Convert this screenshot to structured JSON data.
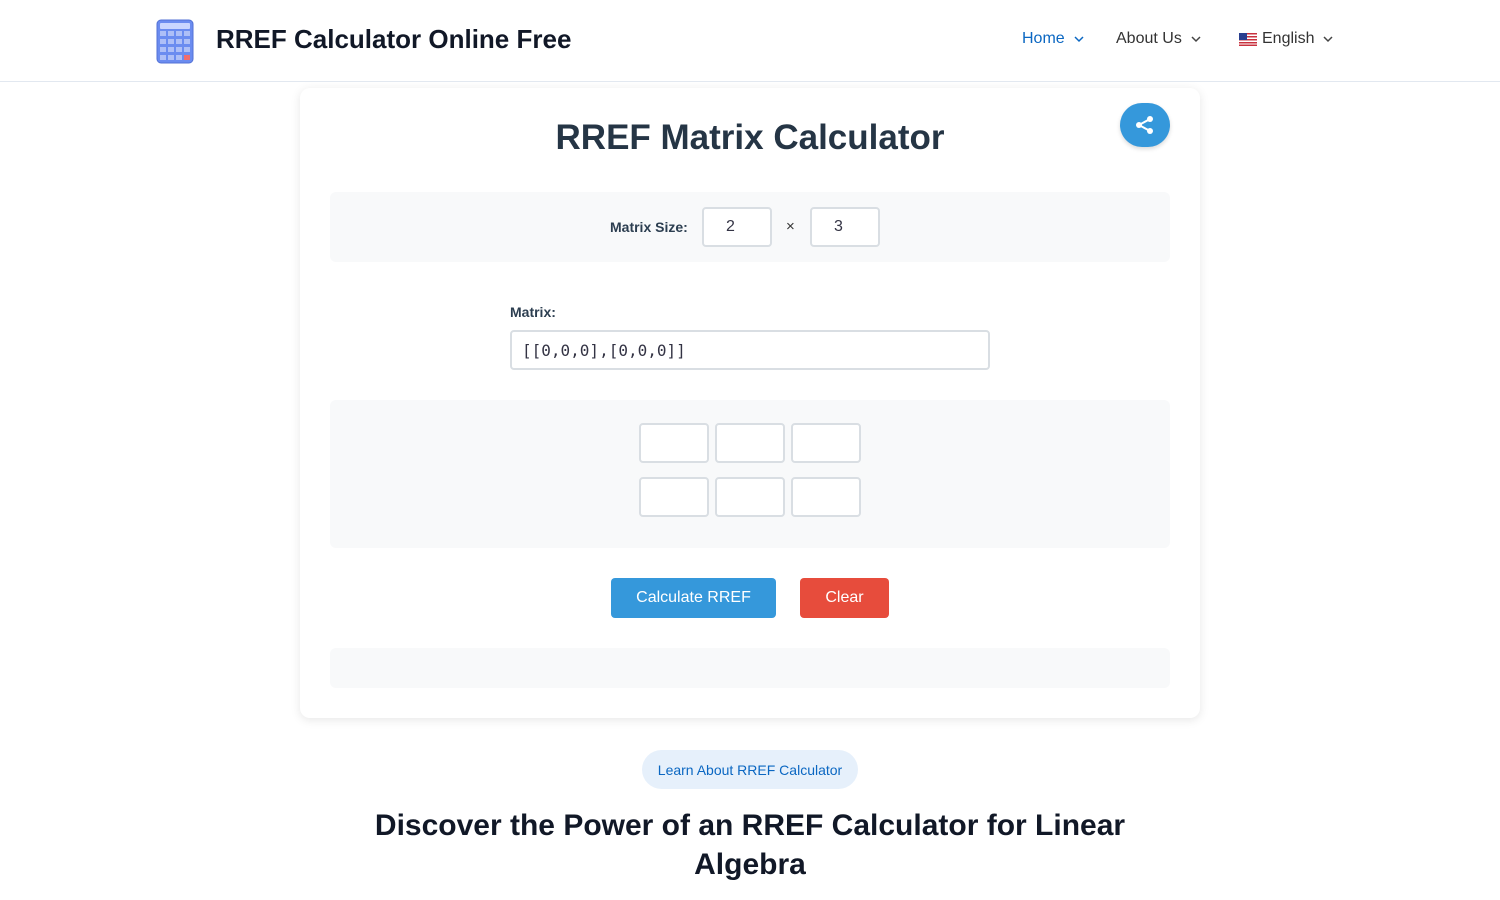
{
  "header": {
    "site_title": "RREF Calculator Online Free",
    "nav": [
      {
        "label": "Home",
        "active": true
      },
      {
        "label": "About Us",
        "active": false
      },
      {
        "label": "English",
        "active": false
      }
    ]
  },
  "calculator": {
    "title": "RREF Matrix Calculator",
    "size_label": "Matrix Size:",
    "rows": "2",
    "cols": "3",
    "times_symbol": "×",
    "matrix_label": "Matrix:",
    "matrix_value": "[[0,0,0],[0,0,0]]",
    "cells": [
      [
        "",
        "",
        ""
      ],
      [
        "",
        "",
        ""
      ]
    ],
    "calculate_label": "Calculate RREF",
    "clear_label": "Clear"
  },
  "content": {
    "learn_label": "Learn About RREF Calculator",
    "heading": "Discover the Power of an RREF Calculator for Linear Algebra"
  },
  "colors": {
    "primary": "#3598db",
    "danger": "#e74c3c",
    "link": "#0b67c2"
  },
  "icons": {
    "logo": "calculator-icon",
    "share": "share-icon",
    "dropdown": "chevron-down-icon",
    "language": "us-flag-icon"
  }
}
